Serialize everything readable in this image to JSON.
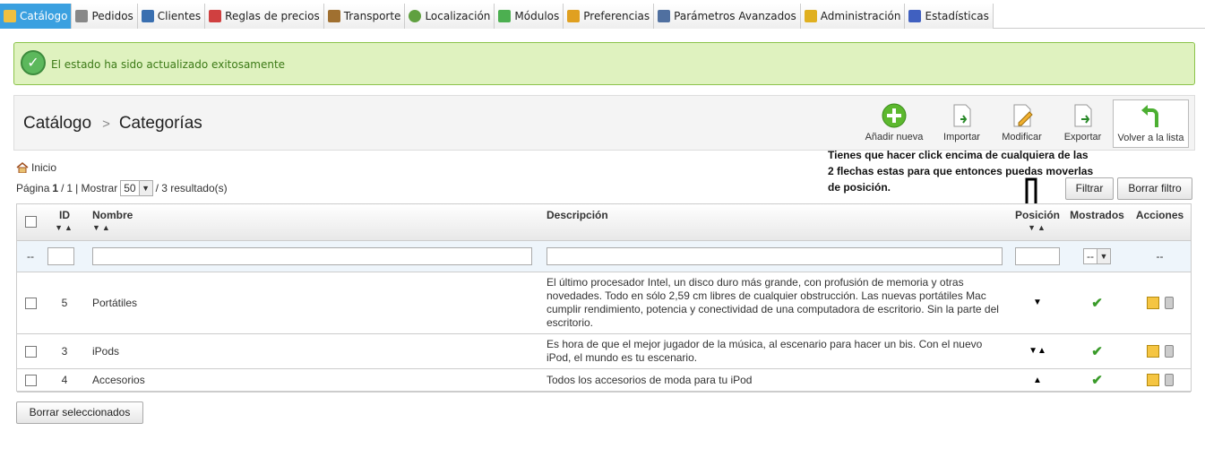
{
  "tabs": [
    {
      "label": "Catálogo",
      "icon": "folder-icon",
      "color": "#f0c040",
      "active": true
    },
    {
      "label": "Pedidos",
      "icon": "cart-icon",
      "color": "#888888"
    },
    {
      "label": "Clientes",
      "icon": "user-icon",
      "color": "#3a6fb0"
    },
    {
      "label": "Reglas de precios",
      "icon": "price-rules-icon",
      "color": "#d04040"
    },
    {
      "label": "Transporte",
      "icon": "truck-icon",
      "color": "#a07030"
    },
    {
      "label": "Localización",
      "icon": "globe-icon",
      "color": "#60a040"
    },
    {
      "label": "Módulos",
      "icon": "puzzle-icon",
      "color": "#4caf50"
    },
    {
      "label": "Preferencias",
      "icon": "preferences-icon",
      "color": "#e0a020"
    },
    {
      "label": "Parámetros Avanzados",
      "icon": "wrench-icon",
      "color": "#5070a0"
    },
    {
      "label": "Administración",
      "icon": "key-icon",
      "color": "#e0b020"
    },
    {
      "label": "Estadísticas",
      "icon": "bar-chart-icon",
      "color": "#4060c0"
    }
  ],
  "confirmation": {
    "message": "El estado ha sido actualizado exitosamente",
    "color": "#dff2bf"
  },
  "breadcrumb": {
    "section": "Catálogo",
    "separator": ">",
    "page": "Categorías"
  },
  "toolbar": {
    "add": "Añadir nueva",
    "import": "Importar",
    "edit": "Modificar",
    "export": "Exportar",
    "back": "Volver a la lista"
  },
  "home": {
    "label": "Inicio"
  },
  "pagination": {
    "page_label": "Página",
    "current": "1",
    "total": "1",
    "show_label": "| Mostrar",
    "per_page": "50",
    "results": "/ 3 resultado(s)"
  },
  "annotation": "Tienes que hacer click encima de cualquiera de las 2 flechas estas para que entonces puedas moverlas  de posición.",
  "buttons": {
    "filter": "Filtrar",
    "reset_filter": "Borrar filtro",
    "delete_selected": "Borrar seleccionados"
  },
  "table": {
    "headers": {
      "id": "ID",
      "name": "Nombre",
      "description": "Descripción",
      "position": "Posición",
      "displayed": "Mostrados",
      "actions": "Acciones"
    },
    "filter": {
      "dash": "--",
      "displayed_select": "--",
      "actions_dash": "--"
    },
    "rows": [
      {
        "id": "5",
        "name": "Portátiles",
        "description": "El último procesador Intel, un disco duro más grande, con profusión de memoria y otras novedades. Todo en sólo 2,59 cm libres de cualquier obstrucción. Las nuevas portátiles Mac cumplir rendimiento, potencia y conectividad de una computadora de escritorio. Sin la parte del escritorio.",
        "position_arrows": "▼",
        "displayed": "✔"
      },
      {
        "id": "3",
        "name": "iPods",
        "description": "Es hora de que el mejor jugador de la música, al escenario para hacer un bis. Con el nuevo iPod, el mundo es tu escenario.",
        "position_arrows": "▼▲",
        "displayed": "✔"
      },
      {
        "id": "4",
        "name": "Accesorios",
        "description": "Todos los accesorios de moda para tu iPod",
        "position_arrows": "▲",
        "displayed": "✔"
      }
    ]
  }
}
